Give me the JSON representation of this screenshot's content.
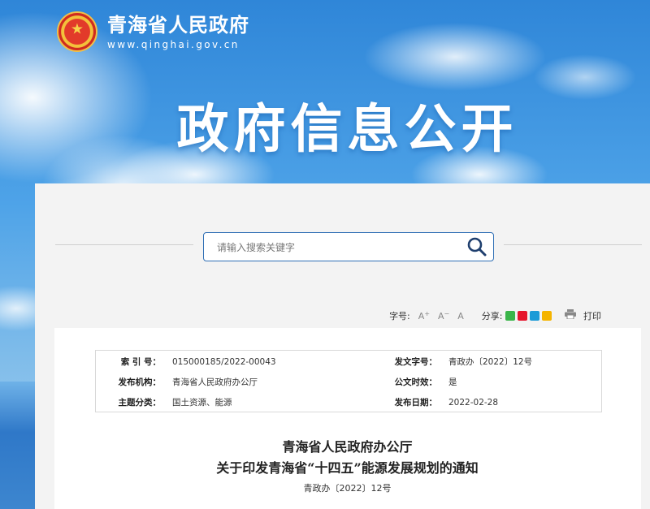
{
  "header": {
    "site_name": "青海省人民政府",
    "site_url": "www.qinghai.gov.cn",
    "banner_title": "政府信息公开"
  },
  "search": {
    "placeholder": "请输入搜索关键字"
  },
  "toolbar": {
    "font_size_label": "字号:",
    "font_increase": "A",
    "font_decrease": "A",
    "font_reset": "A",
    "share_label": "分享:",
    "share_icons": [
      "wechat-icon",
      "weibo-icon",
      "qq-icon",
      "qzone-icon"
    ],
    "print_label": "打印"
  },
  "meta": {
    "index_label": "索 引 号：",
    "index_value": "015000185/2022-00043",
    "doc_no_label": "发文字号：",
    "doc_no_value": "青政办〔2022〕12号",
    "publisher_label": "发布机构：",
    "publisher_value": "青海省人民政府办公厅",
    "validity_label": "公文时效：",
    "validity_value": "是",
    "topic_label": "主题分类：",
    "topic_value": "国土资源、能源",
    "date_label": "发布日期：",
    "date_value": "2022-02-28"
  },
  "document": {
    "org": "青海省人民政府办公厅",
    "title": "关于印发青海省“十四五”能源发展规划的通知",
    "number": "青政办〔2022〕12号"
  },
  "colors": {
    "search_border": "#2f6fb5",
    "wechat": "#3bb54a",
    "weibo": "#e6162d",
    "qq": "#1d9bd7",
    "qzone": "#f5b400"
  }
}
